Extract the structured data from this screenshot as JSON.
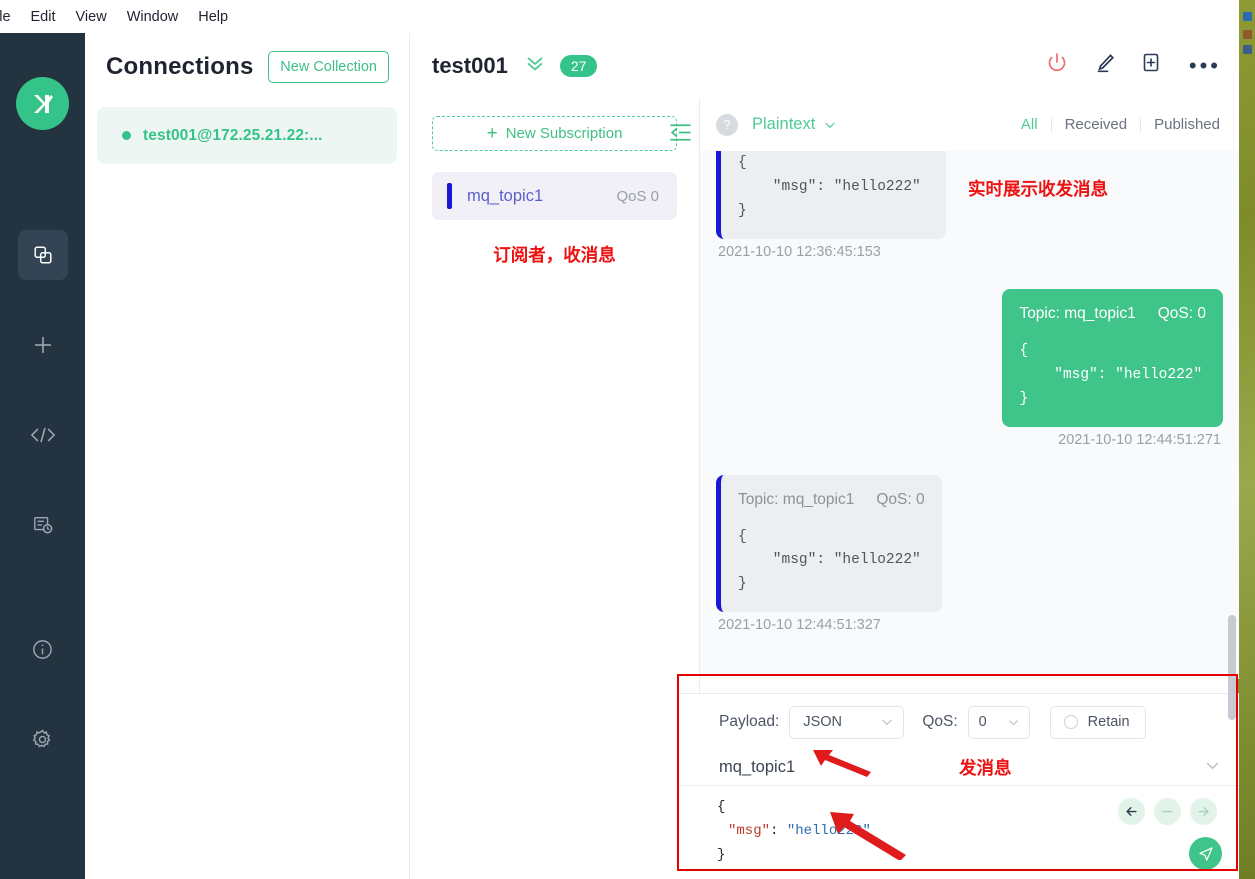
{
  "menubar": {
    "items": [
      "ile",
      "Edit",
      "View",
      "Window",
      "Help"
    ]
  },
  "rail": {
    "logo_name": "mqttx-logo",
    "items": [
      {
        "name": "connections-icon",
        "label": "Connections",
        "active": true
      },
      {
        "name": "new-connection-icon",
        "label": "New Connection",
        "active": false
      },
      {
        "name": "code-icon",
        "label": "Script",
        "active": false
      },
      {
        "name": "log-icon",
        "label": "Log",
        "active": false
      },
      {
        "name": "info-icon",
        "label": "About",
        "active": false
      },
      {
        "name": "settings-icon",
        "label": "Settings",
        "active": false
      }
    ]
  },
  "connections": {
    "title": "Connections",
    "new_collection_label": "New Collection",
    "items": [
      {
        "label": "test001@172.25.21.22:...",
        "status": "connected"
      }
    ]
  },
  "subscriptions": {
    "new_subscription_label": "New Subscription",
    "plus": "+",
    "items": [
      {
        "topic": "mq_topic1",
        "qos": "QoS 0",
        "color": "#1a17d6"
      }
    ],
    "annotation": "订阅者，收消息"
  },
  "header": {
    "connection_name": "test001",
    "message_count": "27",
    "icons": [
      "power-icon",
      "edit-icon",
      "new-window-icon",
      "more-icon"
    ]
  },
  "messages_toolbar": {
    "help": "?",
    "format": "Plaintext",
    "filters": [
      {
        "label": "All",
        "active": true
      },
      {
        "label": "Received",
        "active": false
      },
      {
        "label": "Published",
        "active": false
      }
    ]
  },
  "conversation": {
    "annotation": "实时展示收发消息",
    "messages": [
      {
        "direction": "received",
        "meta": "",
        "topic": "",
        "qos": "",
        "payload": "{\n    \"msg\": \"hello222\"\n}",
        "time": "2021-10-10 12:36:45:153"
      },
      {
        "direction": "published",
        "topic": "Topic: mq_topic1",
        "qos": "QoS: 0",
        "payload": "{\n    \"msg\": \"hello222\"\n}",
        "time": "2021-10-10 12:44:51:271"
      },
      {
        "direction": "received",
        "topic": "Topic: mq_topic1",
        "qos": "QoS: 0",
        "payload": "{\n    \"msg\": \"hello222\"\n}",
        "time": "2021-10-10 12:44:51:327"
      }
    ]
  },
  "composer": {
    "payload_label": "Payload:",
    "payload_value": "JSON",
    "qos_label": "QoS:",
    "qos_value": "0",
    "retain_label": "Retain",
    "retain_checked": false,
    "topic_value": "mq_topic1",
    "annotation": "发消息",
    "editor": {
      "line1": "{",
      "line2_key": "\"msg\"",
      "line2_colon": ": ",
      "line2_value": "\"hello222\"",
      "line3": "}"
    },
    "nav": [
      "back-arrow",
      "minus",
      "forward-arrow"
    ],
    "send_icon": "send-icon"
  },
  "colors": {
    "brand_green": "#34c388",
    "accent_green": "#3fbf84",
    "bubble_out": "#3fc48a",
    "sub_blue": "#1a17d6",
    "annotation_red": "#ee1111",
    "rail_bg": "#243340",
    "power_red": "#f16b6b"
  }
}
